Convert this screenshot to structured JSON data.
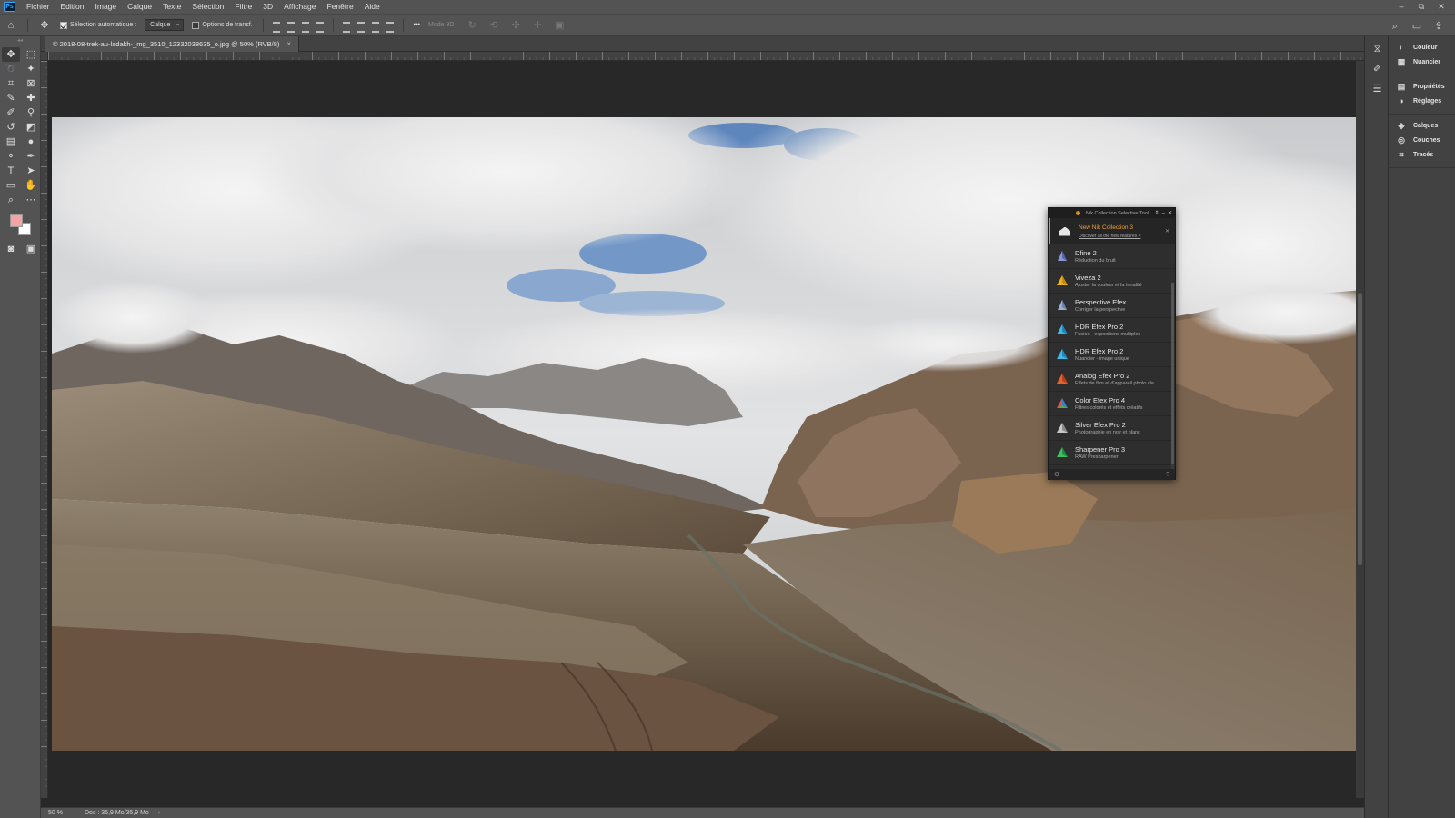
{
  "app": {
    "logo": "Ps"
  },
  "menu": [
    "Fichier",
    "Edition",
    "Image",
    "Calque",
    "Texte",
    "Sélection",
    "Filtre",
    "3D",
    "Affichage",
    "Fenêtre",
    "Aide"
  ],
  "window_controls": {
    "minimize": "–",
    "restore": "⧉",
    "close": "✕"
  },
  "options_bar": {
    "auto_select_label": "Sélection automatique :",
    "auto_select_value": "Calque",
    "transform_label": "Options de transf.",
    "more": "•••",
    "mode3d_label": "Mode 3D :"
  },
  "document": {
    "tab_title": "© 2018-08-trek-au-ladakh-_mg_3510_12332038635_o.jpg @ 50% (RVB/8)",
    "tab_close": "×"
  },
  "status": {
    "zoom": "50 %",
    "doc_info": "Doc : 35,9 Mo/35,9 Mo",
    "arrow": "›"
  },
  "right_panels": [
    {
      "label": "Couleur",
      "icon": "color-wheel-icon",
      "glyph": "◐"
    },
    {
      "label": "Nuancier",
      "icon": "swatches-grid-icon",
      "glyph": "▦"
    },
    {
      "label": "Propriétés",
      "icon": "properties-icon",
      "glyph": "▤"
    },
    {
      "label": "Réglages",
      "icon": "adjustments-icon",
      "glyph": "◑"
    },
    {
      "label": "Calques",
      "icon": "layers-icon",
      "glyph": "◈"
    },
    {
      "label": "Couches",
      "icon": "channels-icon",
      "glyph": "◎"
    },
    {
      "label": "Tracés",
      "icon": "paths-icon",
      "glyph": "⌗"
    }
  ],
  "nik_panel": {
    "title": "Nik Collection Selective Tool",
    "banner_title": "New Nik Collection 3",
    "banner_link": "Discover all the new features >",
    "items": [
      {
        "name": "Dfine 2",
        "desc": "Réduction du bruit",
        "color": "#8a9ad0",
        "color2": "#5566aa"
      },
      {
        "name": "Viveza 2",
        "desc": "Ajuster la couleur et la tonalité",
        "color": "#f0b020",
        "color2": "#c88a10"
      },
      {
        "name": "Perspective Efex",
        "desc": "Corriger la perspective",
        "color": "#9ab0d0",
        "color2": "#6a80a8"
      },
      {
        "name": "HDR Efex Pro 2",
        "desc": "Fusion - expositions multiples",
        "color": "#40b8e8",
        "color2": "#1a88c0"
      },
      {
        "name": "HDR Efex Pro 2",
        "desc": "Nuancier - image unique",
        "color": "#40b8e8",
        "color2": "#1a88c0"
      },
      {
        "name": "Analog Efex Pro 2",
        "desc": "Effets de film et d'appareil photo cla...",
        "color": "#e8602a",
        "color2": "#b84018"
      },
      {
        "name": "Color Efex Pro 4",
        "desc": "Filtres colorés et effets créatifs",
        "color": "#e85040",
        "color2": "#3a80d0"
      },
      {
        "name": "Silver Efex Pro 2",
        "desc": "Photographie en noir et blanc",
        "color": "#c8c8c8",
        "color2": "#8a8a8a"
      },
      {
        "name": "Sharpener Pro 3",
        "desc": "RAW Presharpener",
        "color": "#40c060",
        "color2": "#208a40"
      }
    ],
    "footer_left": "⚙",
    "footer_right": "?"
  },
  "colors": {
    "foreground": "#f4a4a4",
    "background": "#ffffff",
    "accent": "#e89522"
  }
}
